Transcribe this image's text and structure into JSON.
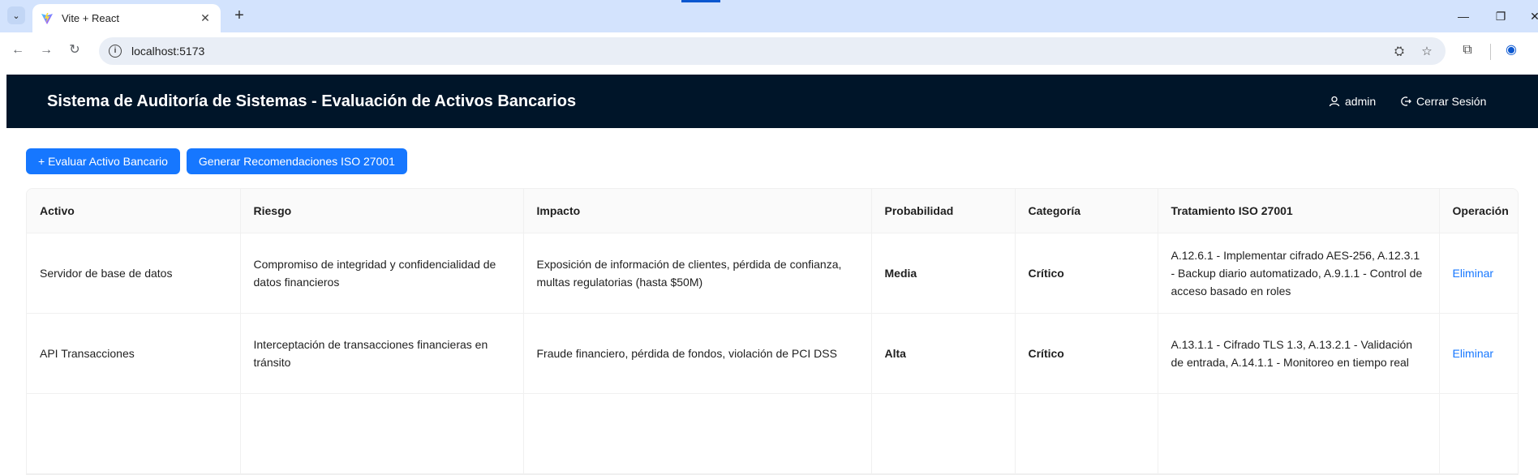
{
  "browser": {
    "tab_title": "Vite + React",
    "url": "localhost:5173"
  },
  "app": {
    "title": "Sistema de Auditoría de Sistemas - Evaluación de Activos Bancarios",
    "user": "admin",
    "logout": "Cerrar Sesión"
  },
  "actions": {
    "evaluate": "+ Evaluar Activo Bancario",
    "recommend": "Generar Recomendaciones ISO 27001"
  },
  "table": {
    "headers": [
      "Activo",
      "Riesgo",
      "Impacto",
      "Probabilidad",
      "Categoría",
      "Tratamiento ISO 27001",
      "Operación"
    ],
    "rows": [
      {
        "activo": "Servidor de base de datos",
        "riesgo": "Compromiso de integridad y confidencialidad de datos financieros",
        "impacto": "Exposición de información de clientes, pérdida de confianza, multas regulatorias (hasta $50M)",
        "probabilidad": "Media",
        "categoria": "Crítico",
        "tratamiento": "A.12.6.1 - Implementar cifrado AES-256, A.12.3.1 - Backup diario automatizado, A.9.1.1 - Control de acceso basado en roles",
        "operacion": "Eliminar"
      },
      {
        "activo": "API Transacciones",
        "riesgo": "Interceptación de transacciones financieras en tránsito",
        "impacto": "Fraude financiero, pérdida de fondos, violación de PCI DSS",
        "probabilidad": "Alta",
        "categoria": "Crítico",
        "tratamiento": "A.13.1.1 - Cifrado TLS 1.3, A.13.2.1 - Validación de entrada, A.14.1.1 - Monitoreo en tiempo real",
        "operacion": "Eliminar"
      }
    ]
  },
  "colors": {
    "header_bg": "#001529",
    "primary": "#1677ff",
    "media": "#faad14",
    "alta": "#ff4d4f",
    "critico": "#ff4d4f"
  }
}
